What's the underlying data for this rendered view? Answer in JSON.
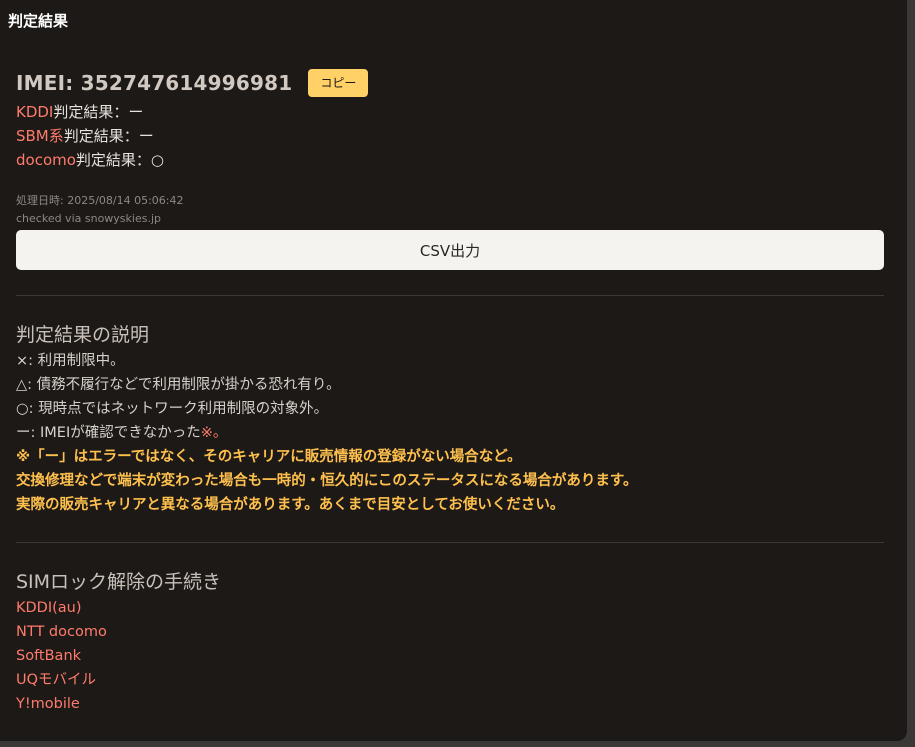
{
  "panel": {
    "title": "判定結果"
  },
  "imei": {
    "text": "IMEI: 352747614996981",
    "copy_label": "コピー"
  },
  "results": [
    {
      "carrier": "KDDI",
      "label": "判定結果：ー"
    },
    {
      "carrier": "SBM系",
      "label": "判定結果：ー"
    },
    {
      "carrier": "docomo",
      "label": "判定結果：○"
    }
  ],
  "meta": {
    "processed": "処理日時: 2025/08/14 05:06:42",
    "checked_via": "checked via snowyskies.jp"
  },
  "csv_label": "CSV出力",
  "explanation": {
    "title": "判定結果の説明",
    "lines": [
      "×: 利用制限中。",
      "△: 債務不履行などで利用制限が掛かる恐れ有り。",
      "○: 現時点ではネットワーク利用制限の対象外。"
    ],
    "last_line_prefix": "ー: IMEIが確認できなかった",
    "last_line_mark": "※。",
    "warnings": [
      "※「ー」はエラーではなく、そのキャリアに販売情報の登録がない場合など。",
      "交換修理などで端末が変わった場合も一時的・恒久的にこのステータスになる場合があります。",
      "実際の販売キャリアと異なる場合があります。あくまで目安としてお使いください。"
    ]
  },
  "unlock": {
    "title": "SIMロック解除の手続き",
    "links": [
      "KDDI(au)",
      "NTT docomo",
      "SoftBank",
      "UQモバイル",
      "Y!mobile"
    ]
  },
  "colors": {
    "accent_carrier": "#ff7b6b",
    "warning": "#ffc04d",
    "copy_button": "#ffd166",
    "panel_bg": "#1c1917"
  }
}
